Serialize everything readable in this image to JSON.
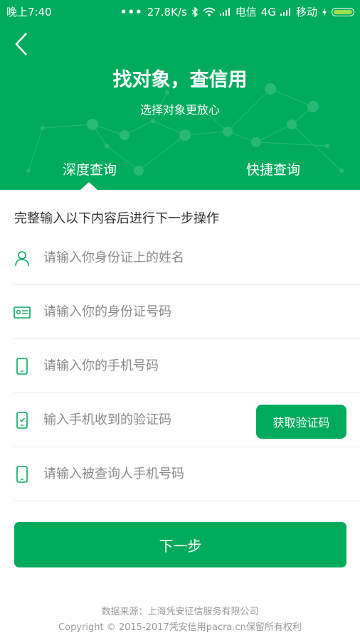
{
  "status_bar": {
    "time": "晚上7:40",
    "dots": "•••",
    "speed": "27.8K/s",
    "carrier1": "电信",
    "network": "4G",
    "carrier2": "移动",
    "icons": [
      "bluetooth-icon",
      "wifi-icon",
      "signal-icon",
      "battery-icon",
      "charging-icon"
    ]
  },
  "header": {
    "title": "找对象，查信用",
    "subtitle": "选择对象更放心",
    "back_icon": "chevron-left-icon"
  },
  "tabs": [
    {
      "label": "深度查询",
      "active": true
    },
    {
      "label": "快捷查询",
      "active": false
    }
  ],
  "form": {
    "instruction": "完整输入以下内容后进行下一步操作",
    "fields": [
      {
        "placeholder": "请输入你身份证上的姓名",
        "value": "",
        "icon": "person-icon"
      },
      {
        "placeholder": "请输入你的身份证号码",
        "value": "",
        "icon": "id-card-icon"
      },
      {
        "placeholder": "请输入你的手机号码",
        "value": "",
        "icon": "phone-icon"
      },
      {
        "placeholder": "输入手机收到的验证码",
        "value": "",
        "icon": "phone-verify-icon"
      },
      {
        "placeholder": "请输入被查询人手机号码",
        "value": "",
        "icon": "phone-icon"
      }
    ],
    "get_code_label": "获取验证码",
    "next_label": "下一步"
  },
  "footer": {
    "source": "数据来源：上海凭安征信服务有限公司",
    "copyright": "Copyright © 2015-2017凭安信用pacra.cn保留所有权利"
  },
  "colors": {
    "brand": "#00ac5c",
    "battery": "#9be24a",
    "placeholder": "#8a8a8a"
  }
}
